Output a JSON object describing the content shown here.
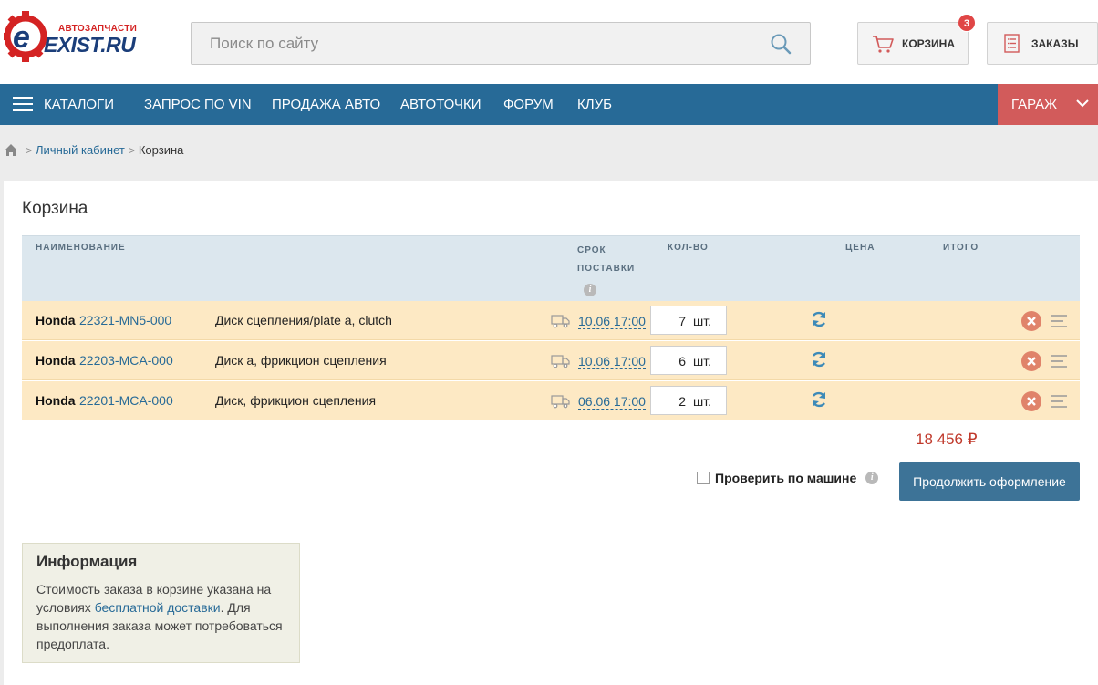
{
  "header": {
    "logo_top": "АВТОЗАПЧАСТИ",
    "logo_brand": "EXIST.RU",
    "search_placeholder": "Поиск по сайту",
    "cart_label": "КОРЗИНА",
    "cart_count": "3",
    "orders_label": "ЗАКАЗЫ"
  },
  "nav": {
    "items": [
      "КАТАЛОГИ",
      "ЗАПРОС ПО VIN",
      "ПРОДАЖА АВТО",
      "АВТОТОЧКИ",
      "ФОРУМ",
      "КЛУБ"
    ],
    "garage": "ГАРАЖ"
  },
  "breadcrumb": {
    "link": "Личный кабинет",
    "current": "Корзина"
  },
  "cart": {
    "title": "Корзина",
    "columns": {
      "name": "НАИМЕНОВАНИЕ",
      "delivery_1": "СРОК",
      "delivery_2": "ПОСТАВКИ",
      "qty": "КОЛ-ВО",
      "price": "ЦЕНА",
      "total": "ИТОГО"
    },
    "info_glyph": "i",
    "rows": [
      {
        "brand": "Honda",
        "part": "22321-MN5-000",
        "desc": "Диск сцепления/plate a, clutch",
        "date": "10.06 17:00",
        "qty": "7",
        "unit": "шт."
      },
      {
        "brand": "Honda",
        "part": "22203-MCA-000",
        "desc": "Диск а, фрикцион сцепления",
        "date": "10.06 17:00",
        "qty": "6",
        "unit": "шт."
      },
      {
        "brand": "Honda",
        "part": "22201-MCA-000",
        "desc": "Диск, фрикцион сцепления",
        "date": "06.06 17:00",
        "qty": "2",
        "unit": "шт."
      }
    ],
    "sum": "18 456 ₽",
    "check_label": "Проверить по машине",
    "continue_label": "Продолжить оформление"
  },
  "info": {
    "title": "Информация",
    "text_before": "Стоимость заказа в корзине указана на условиях ",
    "link": "бесплатной доставки",
    "text_after": ". Для выполнения заказа может потребоваться предоплата."
  },
  "colors": {
    "nav_bg": "#276a97",
    "garage_bg": "#d25b5b",
    "row_bg": "#fde9c4",
    "total_color": "#c0392b",
    "button_bg": "#3d7397"
  }
}
